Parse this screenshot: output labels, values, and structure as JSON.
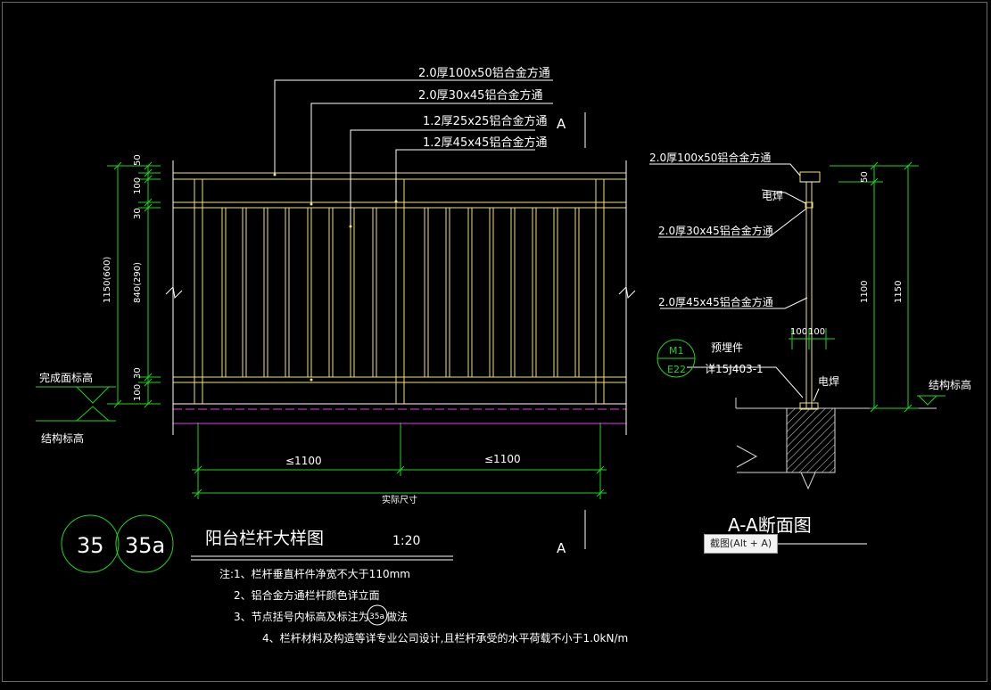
{
  "colors": {
    "background": "#000000",
    "white_lines": "#ffffff",
    "yellow_lines": "#f2e27a",
    "green_lines": "#1fd41f",
    "magenta_lines": "#e040e0",
    "hatch": "#d8d8d8"
  },
  "elevation": {
    "labels": {
      "top_rail": "2.0厚100x50铝合金方通",
      "mid_rail": "2.0厚30x45铝合金方通",
      "baluster": "1.2厚25x25铝合金方通",
      "post": "1.2厚45x45铝合金方通"
    },
    "section_mark_top": "A",
    "section_mark_bottom": "A",
    "left_dims": {
      "d50": "50",
      "d100_top": "100",
      "d30_top": "30",
      "d840": "840(290)",
      "d30_bottom": "30",
      "d100_bottom": "100",
      "d1150": "1150(600)"
    },
    "level_labels": {
      "finish": "完成面标高",
      "structure": "结构标高"
    },
    "bottom_dims": {
      "span_left": "≤1100",
      "span_right": "≤1100",
      "overall": "实际尺寸"
    }
  },
  "section": {
    "labels": {
      "top_rail": "2.0厚100x50铝合金方通",
      "weld_top": "电焊",
      "mid_rail": "2.0厚30x45铝合金方通",
      "post": "2.0厚45x45铝合金方通",
      "embed": "预埋件",
      "embed_ref": "详15J403-1",
      "weld_bottom": "电焊",
      "structure": "结构标高"
    },
    "callout": {
      "top": "M1",
      "bottom": "E22"
    },
    "dims": {
      "d50": "50",
      "d1100": "1100",
      "d1150": "1150",
      "d100a": "100",
      "d100b": "100"
    },
    "title": "A-A断面图"
  },
  "title_block": {
    "circle_1": "35",
    "circle_2": "35a",
    "title": "阳台栏杆大样图",
    "scale": "1:20"
  },
  "notes": {
    "n1": "注:1、栏杆垂直杆件净宽不大于110mm",
    "n2": "2、铝合金方通栏杆颜色详立面",
    "n3_prefix": "3、节点括号内标高及标注为",
    "n3_mark": "35a",
    "n3_suffix": "做法",
    "n4": "4、栏杆材料及构造等详专业公司设计,且栏杆承受的水平荷载不小于1.0kN/m"
  },
  "tooltip": {
    "text": "截图(Alt + A)"
  }
}
